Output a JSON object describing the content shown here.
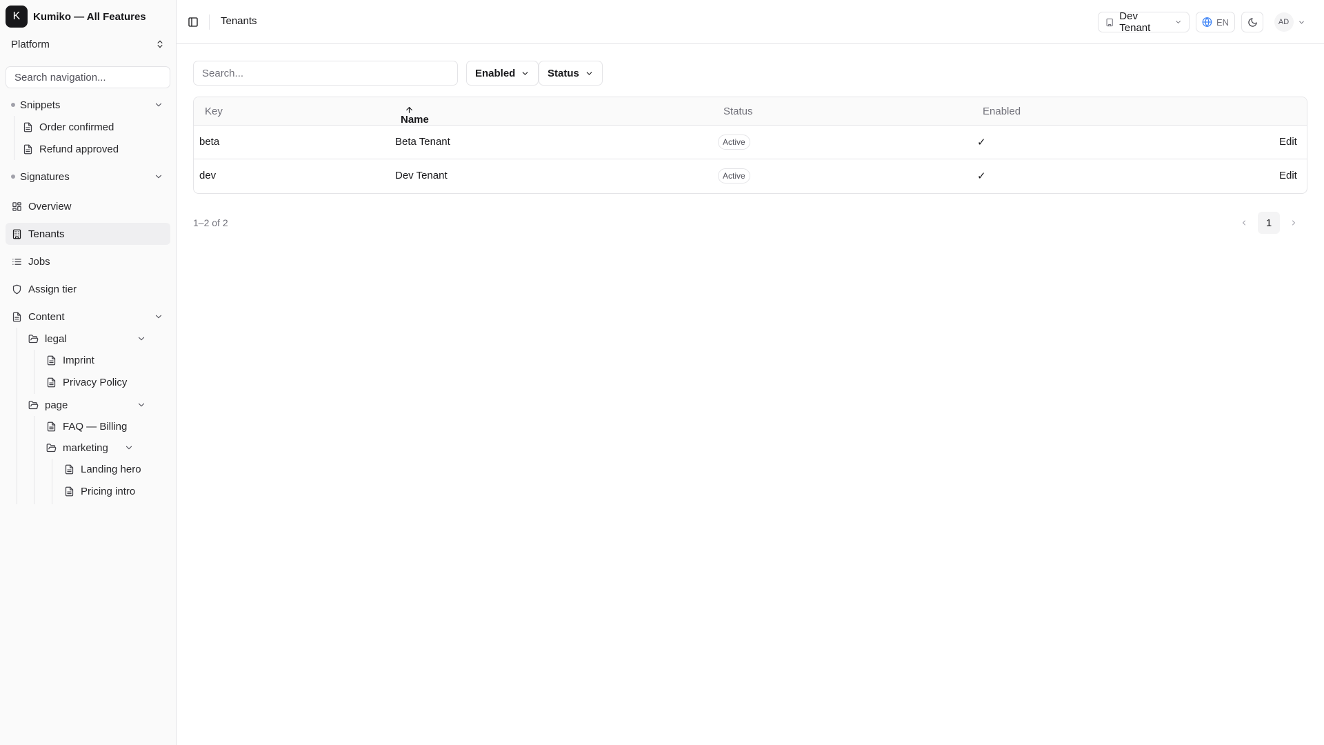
{
  "brand": {
    "logo_letter": "K",
    "title": "Kumiko — All Features"
  },
  "scope": {
    "label": "Platform"
  },
  "nav_search": {
    "placeholder": "Search navigation..."
  },
  "nav": {
    "snippets": {
      "label": "Snippets",
      "children": [
        "Order confirmed",
        "Refund approved"
      ]
    },
    "signatures": {
      "label": "Signatures"
    },
    "overview": "Overview",
    "tenants": "Tenants",
    "jobs": "Jobs",
    "assign_tier": "Assign tier",
    "content": {
      "label": "Content",
      "legal": {
        "label": "legal",
        "children": [
          "Imprint",
          "Privacy Policy"
        ]
      },
      "page": {
        "label": "page",
        "faq": "FAQ — Billing",
        "marketing": {
          "label": "marketing",
          "children": [
            "Landing hero",
            "Pricing intro"
          ]
        }
      }
    }
  },
  "header": {
    "breadcrumb": "Tenants",
    "tenant_switcher": "Dev Tenant",
    "language": "EN",
    "avatar_initials": "AD"
  },
  "toolbar": {
    "search_placeholder": "Search...",
    "filter_enabled": "Enabled",
    "filter_status": "Status"
  },
  "table": {
    "columns": {
      "key": "Key",
      "name": "Name",
      "status": "Status",
      "enabled": "Enabled"
    },
    "sort": {
      "column": "Name",
      "direction": "asc"
    },
    "rows": [
      {
        "key": "beta",
        "name": "Beta Tenant",
        "status": "Active",
        "enabled": "✓",
        "action": "Edit"
      },
      {
        "key": "dev",
        "name": "Dev Tenant",
        "status": "Active",
        "enabled": "✓",
        "action": "Edit"
      }
    ]
  },
  "pagination": {
    "summary": "1–2 of 2",
    "current_page": "1"
  },
  "colors": {
    "text": "#18181b",
    "muted": "#71717a",
    "border": "#e4e4e7",
    "sidebar_bg": "#fafafa",
    "active_bg": "#efeff1"
  }
}
